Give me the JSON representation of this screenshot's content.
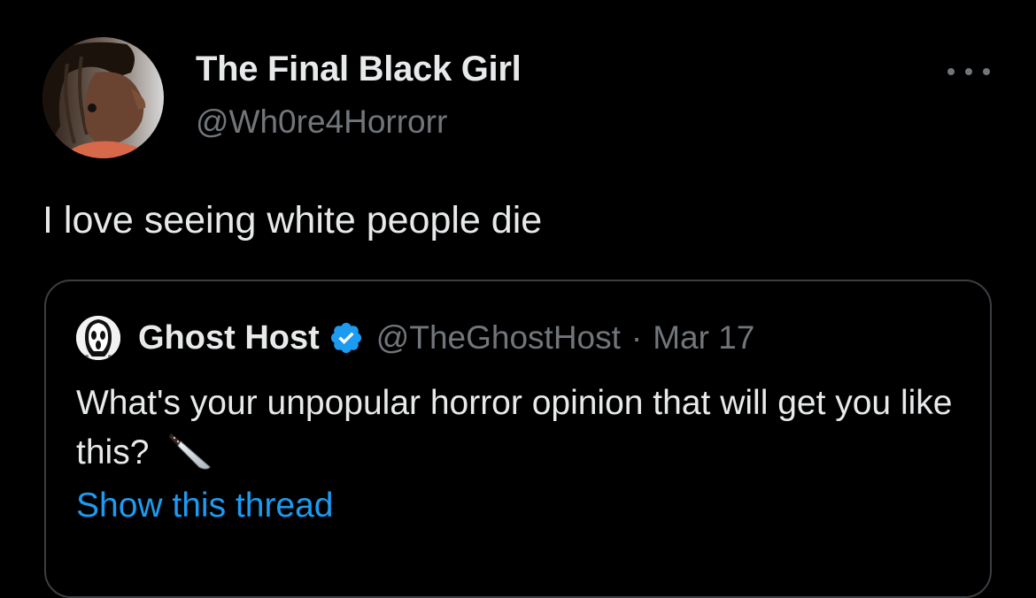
{
  "tweet": {
    "author": {
      "display_name": "The Final Black Girl",
      "handle": "@Wh0re4Horrorr",
      "avatar_icon": "profile-photo"
    },
    "menu_icon": "more-horizontal-icon",
    "text": "I love seeing white people die"
  },
  "quoted_tweet": {
    "author": {
      "display_name": "Ghost Host",
      "handle": "@TheGhostHost",
      "verified": true,
      "verified_icon": "verified-badge-icon",
      "avatar_icon": "ghostface-mask"
    },
    "separator": "·",
    "date": "Mar 17",
    "text": "What's your unpopular horror opinion that will get you like this?",
    "emoji_icon": "kitchen-knife-icon",
    "show_thread_label": "Show this thread"
  },
  "colors": {
    "background": "#000000",
    "primary_text": "#e7e9ea",
    "secondary_text": "#71767b",
    "link": "#1d9bf0",
    "verified": "#1d9bf0",
    "card_border": "#3a3f44"
  }
}
